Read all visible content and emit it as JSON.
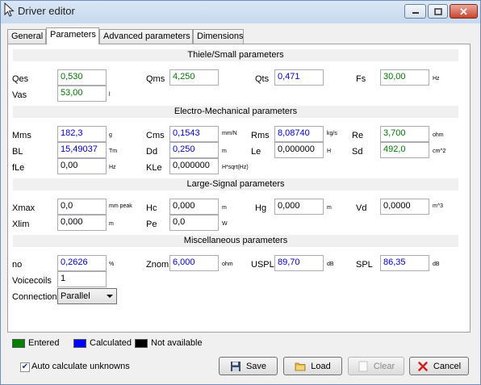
{
  "window": {
    "title": "Driver editor"
  },
  "tabs": [
    "General",
    "Parameters",
    "Advanced parameters",
    "Dimensions"
  ],
  "sections": {
    "ts": "Thiele/Small parameters",
    "em": "Electro-Mechanical parameters",
    "ls": "Large-Signal parameters",
    "misc": "Miscellaneous parameters"
  },
  "params": {
    "qes": {
      "label": "Qes",
      "value": "0,530",
      "unit": ""
    },
    "qms": {
      "label": "Qms",
      "value": "4,250",
      "unit": ""
    },
    "qts": {
      "label": "Qts",
      "value": "0,471",
      "unit": ""
    },
    "fs": {
      "label": "Fs",
      "value": "30,00",
      "unit": "Hz"
    },
    "vas": {
      "label": "Vas",
      "value": "53,00",
      "unit": "l"
    },
    "mms": {
      "label": "Mms",
      "value": "182,3",
      "unit": "g"
    },
    "cms": {
      "label": "Cms",
      "value": "0,1543",
      "unit": "mm/N"
    },
    "rms": {
      "label": "Rms",
      "value": "8,08740",
      "unit": "kg/s"
    },
    "re": {
      "label": "Re",
      "value": "3,700",
      "unit": "ohm"
    },
    "bl": {
      "label": "BL",
      "value": "15,49037",
      "unit": "Tm"
    },
    "dd": {
      "label": "Dd",
      "value": "0,250",
      "unit": "m"
    },
    "le": {
      "label": "Le",
      "value": "0,000000",
      "unit": "H"
    },
    "sd": {
      "label": "Sd",
      "value": "492,0",
      "unit": "cm^2"
    },
    "fle": {
      "label": "fLe",
      "value": "0,00",
      "unit": "Hz"
    },
    "kle": {
      "label": "KLe",
      "value": "0,000000",
      "unit": "H*sqrt(Hz)"
    },
    "xmax": {
      "label": "Xmax",
      "value": "0,0",
      "unit": "mm  peak"
    },
    "hc": {
      "label": "Hc",
      "value": "0,000",
      "unit": "m"
    },
    "hg": {
      "label": "Hg",
      "value": "0,000",
      "unit": "m"
    },
    "vd": {
      "label": "Vd",
      "value": "0,0000",
      "unit": "m^3"
    },
    "xlim": {
      "label": "Xlim",
      "value": "0,000",
      "unit": "m"
    },
    "pe": {
      "label": "Pe",
      "value": "0,0",
      "unit": "W"
    },
    "no": {
      "label": "no",
      "value": "0,2626",
      "unit": "%"
    },
    "znom": {
      "label": "Znom",
      "value": "6,000",
      "unit": "ohm"
    },
    "uspl": {
      "label": "USPL",
      "value": "89,70",
      "unit": "dB"
    },
    "spl": {
      "label": "SPL",
      "value": "86,35",
      "unit": "dB"
    },
    "voicecoils": {
      "label": "Voicecoils",
      "value": "1"
    },
    "connection": {
      "label": "Connection",
      "value": "Parallel"
    }
  },
  "legend": {
    "entered": {
      "label": "Entered",
      "color": "#008000"
    },
    "calculated": {
      "label": "Calculated",
      "color": "#0000ff"
    },
    "na": {
      "label": "Not available",
      "color": "#000000"
    }
  },
  "auto_calc": {
    "label": "Auto calculate unknowns",
    "checked": true
  },
  "buttons": {
    "save": "Save",
    "load": "Load",
    "clear": "Clear",
    "cancel": "Cancel"
  },
  "colors": {
    "entered": "#007800",
    "calculated": "#0000c8",
    "accent": "#6d8fb8"
  }
}
